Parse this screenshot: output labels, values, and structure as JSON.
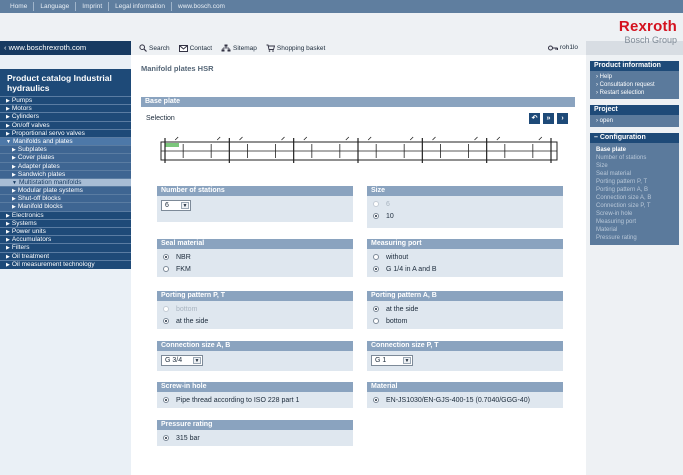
{
  "topnav": [
    "Home",
    "Language",
    "Imprint",
    "Legal information",
    "www.bosch.com"
  ],
  "logo": {
    "brand": "Rexroth",
    "group": "Bosch Group",
    "brand_color": "#d4121f"
  },
  "url": "www.boschrexroth.com",
  "catalog_title": "Product catalog Industrial hydraulics",
  "nav": [
    {
      "label": "Pumps",
      "kind": "top"
    },
    {
      "label": "Motors",
      "kind": "top"
    },
    {
      "label": "Cylinders",
      "kind": "top"
    },
    {
      "label": "On/off valves",
      "kind": "top"
    },
    {
      "label": "Proportional servo valves",
      "kind": "top"
    },
    {
      "label": "Manifolds and plates",
      "kind": "active"
    },
    {
      "label": "Subplates",
      "kind": "sub"
    },
    {
      "label": "Cover plates",
      "kind": "sub"
    },
    {
      "label": "Adapter plates",
      "kind": "sub"
    },
    {
      "label": "Sandwich plates",
      "kind": "sub"
    },
    {
      "label": "Multistation manifolds",
      "kind": "activesub"
    },
    {
      "label": "Modular plate systems",
      "kind": "sub"
    },
    {
      "label": "Shut-off blocks",
      "kind": "sub"
    },
    {
      "label": "Manifold blocks",
      "kind": "sub"
    },
    {
      "label": "Electronics",
      "kind": "top"
    },
    {
      "label": "Systems",
      "kind": "top"
    },
    {
      "label": "Power units",
      "kind": "top"
    },
    {
      "label": "Accumulators",
      "kind": "top"
    },
    {
      "label": "Filters",
      "kind": "top"
    },
    {
      "label": "Oil treatment",
      "kind": "top"
    },
    {
      "label": "Oil measurement technology",
      "kind": "top"
    }
  ],
  "toolbar": {
    "search": "Search",
    "contact": "Contact",
    "sitemap": "Sitemap",
    "basket": "Shopping basket",
    "user": "roh1lo"
  },
  "main": {
    "page_title": "Manifold plates HSR",
    "section": "Base plate",
    "selection_label": "Selection"
  },
  "cards": {
    "stations": {
      "title": "Number of stations",
      "value": "6"
    },
    "size": {
      "title": "Size",
      "options": [
        {
          "label": "6",
          "checked": false,
          "disabled": true
        },
        {
          "label": "10",
          "checked": true,
          "disabled": false
        }
      ]
    },
    "seal": {
      "title": "Seal material",
      "options": [
        {
          "label": "NBR",
          "checked": true,
          "disabled": false
        },
        {
          "label": "FKM",
          "checked": false,
          "disabled": false
        }
      ]
    },
    "port": {
      "title": "Measuring port",
      "options": [
        {
          "label": "without",
          "checked": false,
          "disabled": false
        },
        {
          "label": "G 1/4 in A and B",
          "checked": true,
          "disabled": false
        }
      ]
    },
    "ppt": {
      "title": "Porting pattern P, T",
      "options": [
        {
          "label": "bottom",
          "checked": false,
          "disabled": true
        },
        {
          "label": "at the side",
          "checked": true,
          "disabled": false
        }
      ]
    },
    "pab": {
      "title": "Porting pattern A, B",
      "options": [
        {
          "label": "at the side",
          "checked": true,
          "disabled": false
        },
        {
          "label": "bottom",
          "checked": false,
          "disabled": false
        }
      ]
    },
    "csab": {
      "title": "Connection size A, B",
      "value": "G 3/4"
    },
    "cspt": {
      "title": "Connection size P, T",
      "value": "G 1"
    },
    "screw": {
      "title": "Screw-in hole",
      "options": [
        {
          "label": "Pipe thread according to ISO 228 part 1",
          "checked": true,
          "disabled": false
        }
      ]
    },
    "material": {
      "title": "Material",
      "options": [
        {
          "label": "EN-JS1030/EN-GJS-400-15 (0.7040/GGG-40)",
          "checked": true,
          "disabled": false
        }
      ]
    },
    "pressure": {
      "title": "Pressure rating",
      "options": [
        {
          "label": "315 bar",
          "checked": true,
          "disabled": false
        }
      ]
    }
  },
  "right": {
    "info_title": "Product information",
    "info_items": [
      "Help",
      "Consultation request",
      "Restart selection"
    ],
    "project_title": "Project",
    "project_items": [
      "open"
    ],
    "config_title": "Configuration",
    "config_items": [
      "Base plate",
      "Number of stations",
      "Size",
      "Seal material",
      "Porting pattern P, T",
      "Porting pattern A, B",
      "Connection size A, B",
      "Connection size P, T",
      "Screw-in hole",
      "Measuring port",
      "Material",
      "Pressure rating"
    ]
  }
}
